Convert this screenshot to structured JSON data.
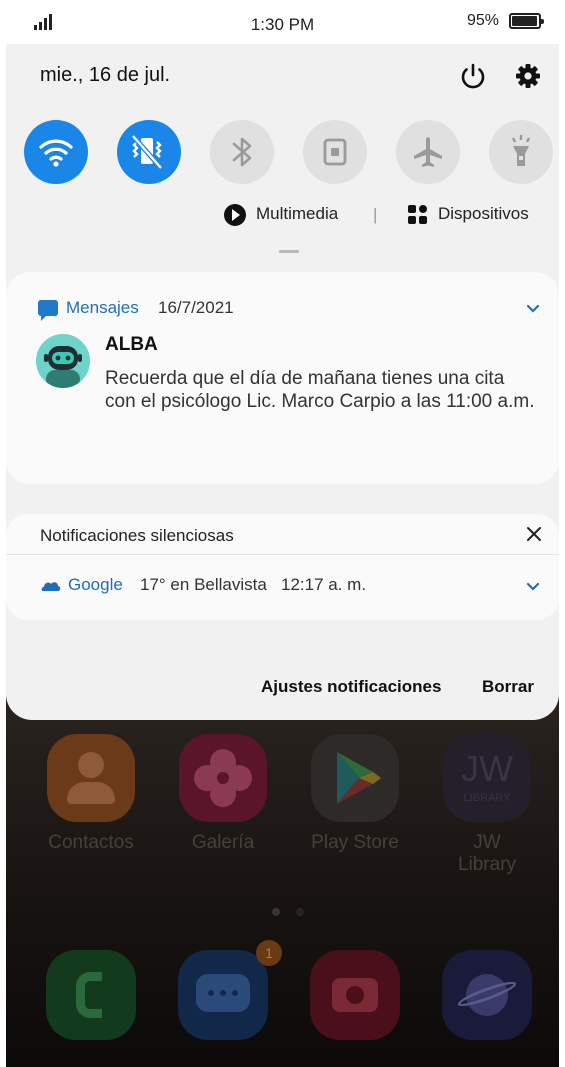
{
  "status_bar": {
    "time": "1:30 PM",
    "battery_pct": "95%",
    "battery_level": 0.95
  },
  "shade": {
    "date": "mie., 16 de jul.",
    "quick_settings": [
      {
        "name": "wifi",
        "icon": "wifi-icon",
        "active": true
      },
      {
        "name": "sound",
        "icon": "vibrate-icon",
        "active": true
      },
      {
        "name": "bluetooth",
        "icon": "bluetooth-icon",
        "active": false
      },
      {
        "name": "rotation-lock",
        "icon": "lock-icon",
        "active": false
      },
      {
        "name": "airplane-mode",
        "icon": "airplane-icon",
        "active": false
      },
      {
        "name": "flashlight",
        "icon": "flashlight-icon",
        "active": false
      }
    ],
    "media_label": "Multimedia",
    "separator": "|",
    "devices_label": "Dispositivos"
  },
  "notification": {
    "app": "Mensajes",
    "time": "16/7/2021",
    "sender": "ALBA",
    "body": "Recuerda que el día de mañana tienes una cita con el psicólogo Lic. Marco Carpio a las 11:00 a.m."
  },
  "silent": {
    "title": "Notificaciones silenciosas",
    "app": "Google",
    "text": "17° en Bellavista   12:17 a. m."
  },
  "footer": {
    "settings_label": "Ajustes notificaciones",
    "clear_label": "Borrar"
  },
  "home": {
    "apps": [
      "Contactos",
      "Galería",
      "Play Store",
      "JW Library"
    ],
    "jw_icon_text": "JW",
    "jw_icon_sub": "LIBRARY",
    "badge": "1"
  },
  "colors": {
    "accent": "#1a87e8",
    "link": "#1f6fb8",
    "panel": "#f1f1f1",
    "card": "#fafafa"
  }
}
